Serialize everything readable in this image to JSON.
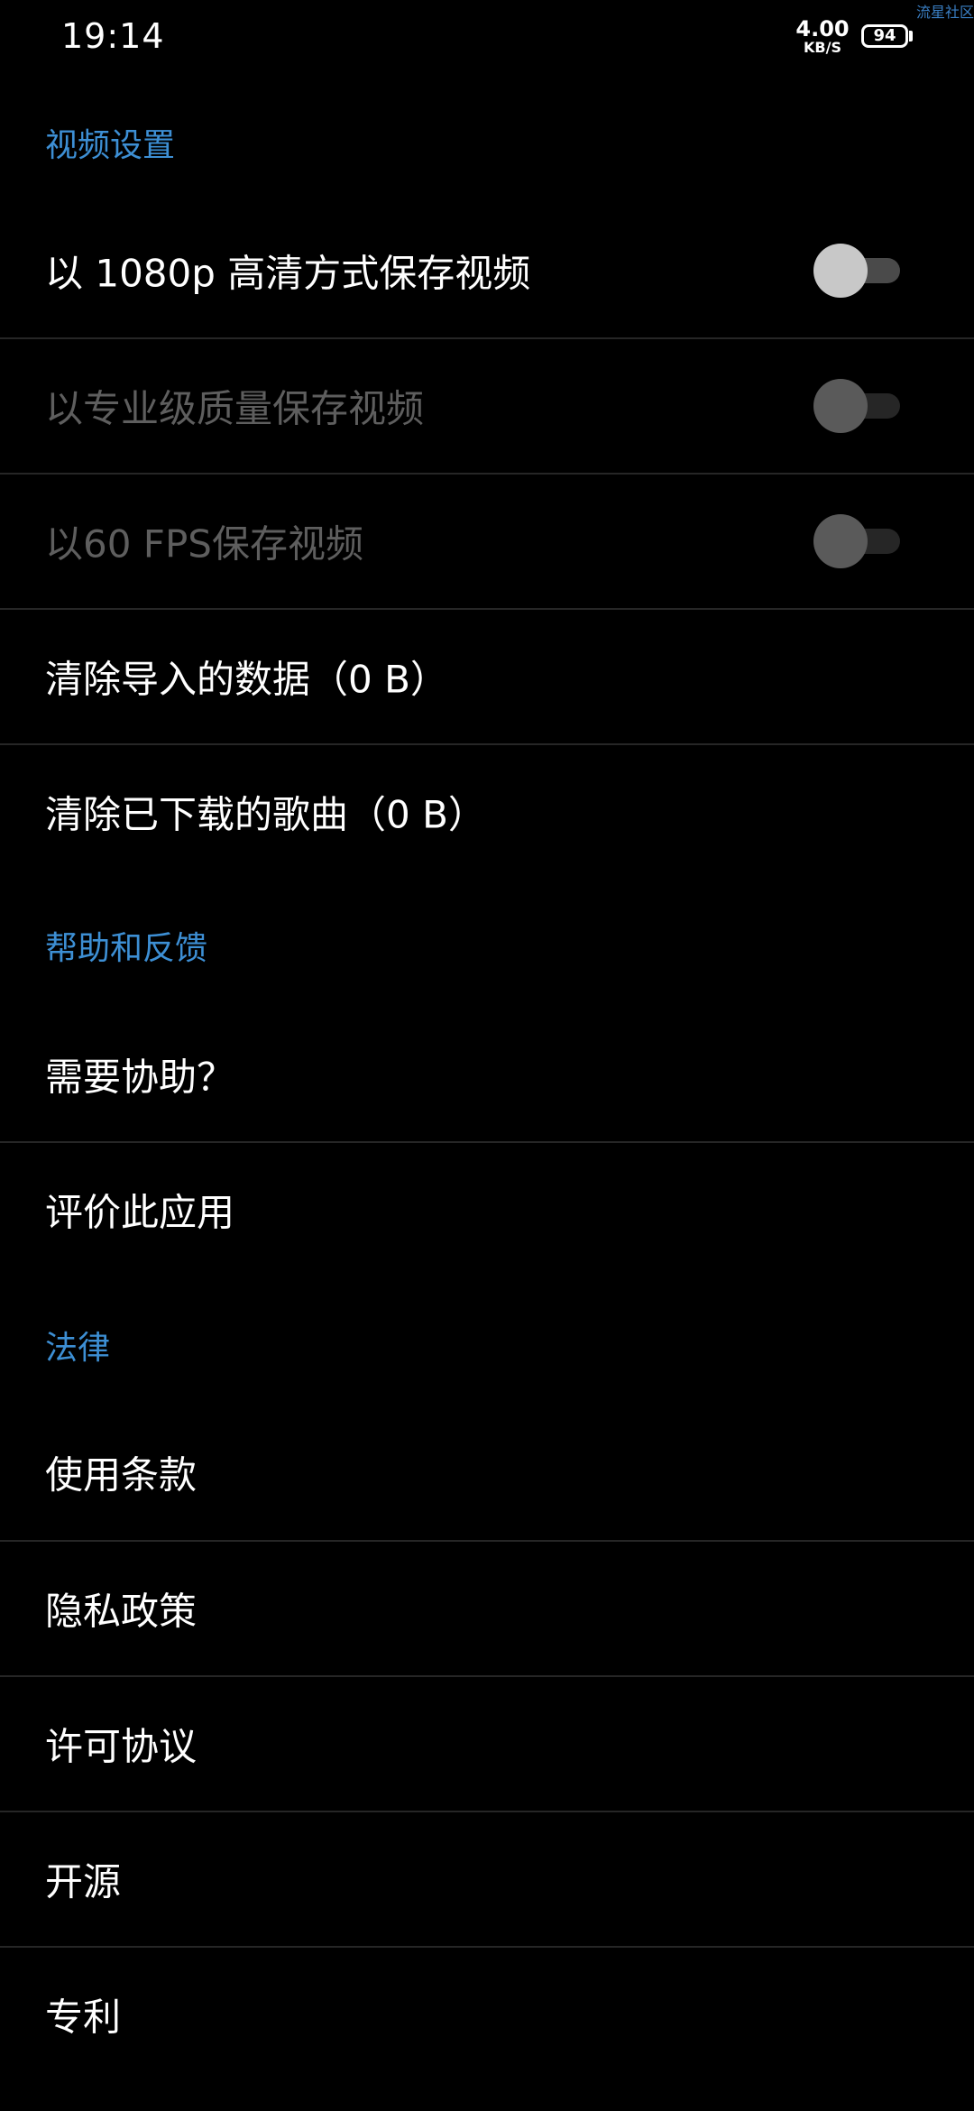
{
  "status_bar": {
    "time": "19:14",
    "net_speed_value": "4.00",
    "net_speed_unit": "KB/S",
    "battery_level": "94",
    "watermark": "流星社区"
  },
  "sections": {
    "video": {
      "header": "视频设置",
      "items": [
        {
          "label": "以 1080p 高清方式保存视频",
          "toggle_on": false,
          "enabled": true
        },
        {
          "label": "以专业级质量保存视频",
          "toggle_on": false,
          "enabled": false
        },
        {
          "label": "以60 FPS保存视频",
          "toggle_on": false,
          "enabled": false
        },
        {
          "label": "清除导入的数据（0 B）"
        },
        {
          "label": "清除已下载的歌曲（0 B）"
        }
      ]
    },
    "help": {
      "header": "帮助和反馈",
      "items": [
        {
          "label": "需要协助？"
        },
        {
          "label": "评价此应用"
        }
      ]
    },
    "legal": {
      "header": "法律",
      "items": [
        {
          "label": "使用条款"
        },
        {
          "label": "隐私政策"
        },
        {
          "label": "许可协议"
        },
        {
          "label": "开源"
        },
        {
          "label": "专利"
        }
      ]
    }
  },
  "colors": {
    "background": "#000000",
    "section_header": "#3d8fd4",
    "text_primary": "#ffffff",
    "text_disabled": "#5e5e5e",
    "divider": "#262626"
  }
}
